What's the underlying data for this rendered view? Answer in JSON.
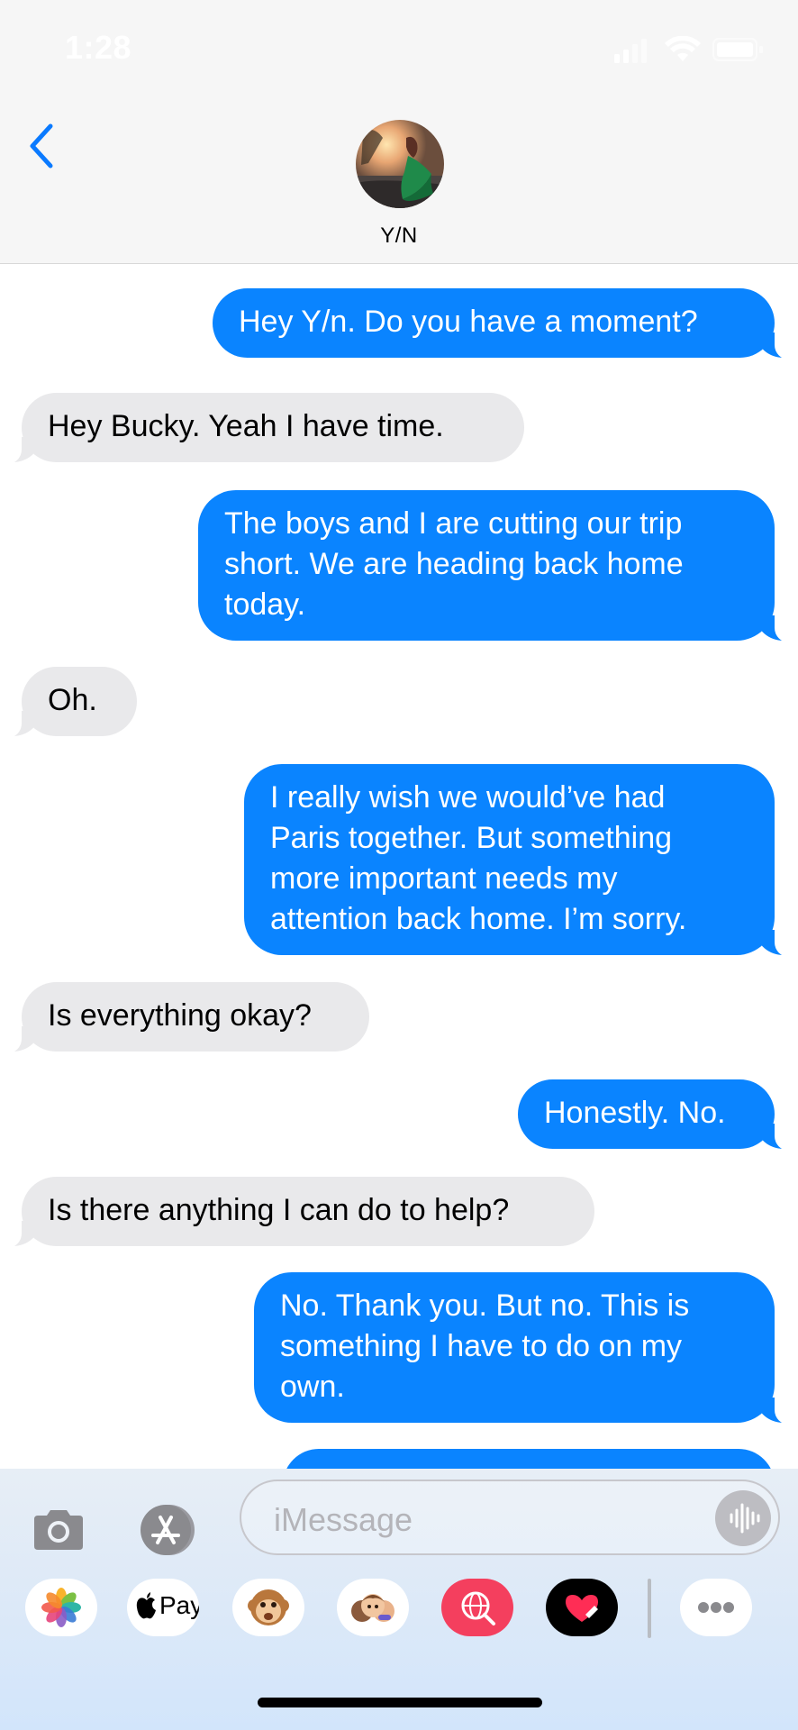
{
  "status_bar": {
    "time": "1:28"
  },
  "header": {
    "contact_name": "Y/N"
  },
  "thread": [
    {
      "from": "me",
      "text": "Hey Y/n. Do you have a moment?"
    },
    {
      "from": "them",
      "text": "Hey Bucky. Yeah I have time."
    },
    {
      "from": "me",
      "lines": [
        "The boys and I are cutting our trip",
        "short. We are heading back home",
        "today."
      ]
    },
    {
      "from": "them",
      "text": "Oh."
    },
    {
      "from": "me",
      "lines": [
        "I really wish we would’ve had",
        "Paris together. But something",
        "more important needs my",
        "attention back home. I’m sorry."
      ]
    },
    {
      "from": "them",
      "text": "Is everything okay?"
    },
    {
      "from": "me",
      "text": "Honestly. No."
    },
    {
      "from": "them",
      "text": "Is there anything I can do to help?"
    },
    {
      "from": "me",
      "lines": [
        "No. Thank you. But no. This is",
        "something I have to do on my",
        "own."
      ]
    }
  ],
  "composer": {
    "placeholder": "iMessage"
  },
  "app_drawer": [
    {
      "name": "photos",
      "icon": "photos-icon"
    },
    {
      "name": "apple-pay",
      "icon": "apple-pay-icon",
      "label": "Pay"
    },
    {
      "name": "animoji",
      "icon": "monkey-animoji-icon"
    },
    {
      "name": "memoji",
      "icon": "memoji-stickers-icon"
    },
    {
      "name": "images-search",
      "icon": "globe-search-icon"
    },
    {
      "name": "digital-touch",
      "icon": "heart-touch-icon"
    },
    {
      "name": "more",
      "icon": "more-dots-icon"
    }
  ],
  "colors": {
    "outgoing": "#0a84ff",
    "incoming": "#e9e9eb",
    "accent": "#0a7aff"
  }
}
